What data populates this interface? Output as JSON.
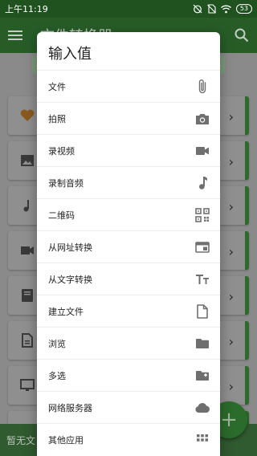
{
  "status_bar": {
    "time": "上午11:19",
    "battery": "53"
  },
  "app": {
    "title": "文件转换器"
  },
  "bottom_bar": {
    "text": "暂无文"
  },
  "fab": {
    "label": "+"
  },
  "dialog": {
    "title": "输入值",
    "items": [
      {
        "label": "文件",
        "icon": "paperclip-icon"
      },
      {
        "label": "拍照",
        "icon": "camera-icon"
      },
      {
        "label": "录视频",
        "icon": "videocam-icon"
      },
      {
        "label": "录制音频",
        "icon": "music-note-icon"
      },
      {
        "label": "二维码",
        "icon": "qr-code-icon"
      },
      {
        "label": "从网址转换",
        "icon": "web-window-icon"
      },
      {
        "label": "从文字转换",
        "icon": "text-format-icon"
      },
      {
        "label": "建立文件",
        "icon": "new-file-icon"
      },
      {
        "label": "浏览",
        "icon": "folder-icon"
      },
      {
        "label": "多选",
        "icon": "folder-add-icon"
      },
      {
        "label": "网络服务器",
        "icon": "cloud-icon"
      },
      {
        "label": "其他应用",
        "icon": "apps-grid-icon"
      }
    ]
  },
  "colors": {
    "primary_dark": "#1f521f",
    "primary": "#275c27",
    "accent": "#2c6b2c",
    "scrim": "#8a8a8a",
    "icon_gray": "#6f6f6f"
  }
}
